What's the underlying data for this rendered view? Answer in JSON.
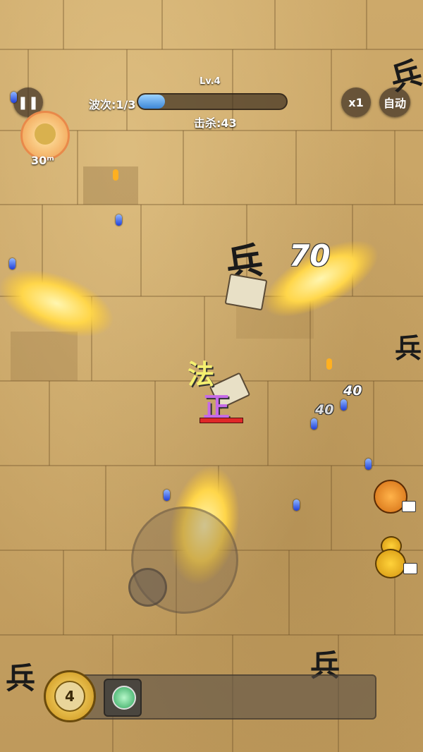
{
  "hud": {
    "level_label": "Lv.4",
    "wave_label": "波次:1/3",
    "wave_progress": 0.18,
    "kills_label": "击杀:43",
    "speed_label": "x1",
    "auto_label": "自动",
    "pause_icon": "pause-icon"
  },
  "portrait": {
    "distance_label": "30ᵐ"
  },
  "combat": {
    "damage_big": "70",
    "damage_small_1": "40",
    "damage_small_2": "40",
    "player_tag_top": "法",
    "player_tag_bottom": "正",
    "enemy_glyph": "兵"
  },
  "powerups": {
    "food_icon": "roast-meat-icon",
    "gourd_icon": "gourd-icon",
    "video_icon": "video-camera-icon"
  },
  "skillbar": {
    "energy_count": "4",
    "slot1_icon": "magnifier-orb-icon"
  },
  "colors": {
    "ground": "#c8a86a",
    "progress_fill": "#3d86d6",
    "gold_slash": "#ffd64a"
  }
}
